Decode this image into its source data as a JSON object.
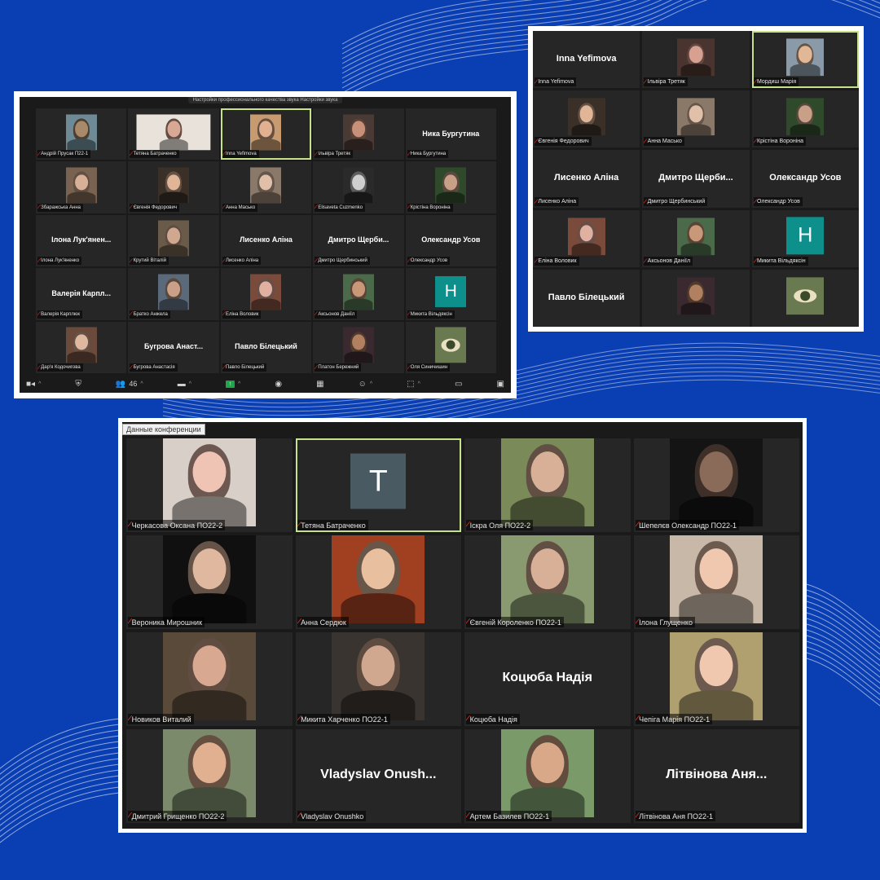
{
  "colors": {
    "background": "#0a3fb3",
    "tile": "#262626",
    "active_border": "#c7e38a",
    "muted_mic": "#e0312b",
    "avatar_teal": "#0d8f8c",
    "avatar_slate": "#4a5a63"
  },
  "top_left": {
    "top_note": "Настройки профессионального качества звука   Настройки звука",
    "tiles": [
      {
        "label": "Андрій Прусак П22-1",
        "type": "photo",
        "tone": "#a88a6a",
        "bg": "#6d8a96"
      },
      {
        "label": "Тетяна Батраченко",
        "type": "photo",
        "tone": "#d9a894",
        "bg": "#e8e2da",
        "wide": true
      },
      {
        "label": "Inna Yefimova",
        "type": "photo",
        "tone": "#e0b090",
        "bg": "#c79a6f",
        "active": true
      },
      {
        "label": "Ільвіра Третяк",
        "type": "photo",
        "tone": "#c89078",
        "bg": "#4a3a36"
      },
      {
        "label": "Ника Бургутина",
        "type": "name",
        "name": "Ника Бургутина"
      },
      {
        "label": "Збаражська Анна",
        "type": "photo",
        "tone": "#d8b098",
        "bg": "#7a6250"
      },
      {
        "label": "Євгенія Федорович",
        "type": "photo",
        "tone": "#e0b598",
        "bg": "#3a3028"
      },
      {
        "label": "Анна Масько",
        "type": "photo",
        "tone": "#e0c0a8",
        "bg": "#8a7868"
      },
      {
        "label": "Elisaveta Cuzmenko",
        "type": "photo",
        "tone": "#cfcfcf",
        "bg": "#2a2a2a"
      },
      {
        "label": "Крістіна Вороніна",
        "type": "photo",
        "tone": "#c8a088",
        "bg": "#2f4a2a"
      },
      {
        "label": "Ілона Лук'яненко",
        "type": "name",
        "name": "Ілона Лук'янен..."
      },
      {
        "label": "Крутий Віталій",
        "type": "photo",
        "tone": "#d0a890",
        "bg": "#6a5a4a"
      },
      {
        "label": "Лисенко Аліна",
        "type": "name",
        "name": "Лисенко Аліна"
      },
      {
        "label": "Дмитро Щербинський",
        "type": "name",
        "name": "Дмитро Щерби..."
      },
      {
        "label": "Олександр Усов",
        "type": "name",
        "name": "Олександр Усов"
      },
      {
        "label": "Валерія Карплюк",
        "type": "name",
        "name": "Валерія Карпл..."
      },
      {
        "label": "Братко Анжела",
        "type": "photo",
        "tone": "#caa088",
        "bg": "#5a6a7a"
      },
      {
        "label": "Еліна Воловик",
        "type": "photo",
        "tone": "#e0b0a0",
        "bg": "#7a4a3a"
      },
      {
        "label": "Аксьонов Даніїл",
        "type": "photo",
        "tone": "#c89878",
        "bg": "#4a6a4a"
      },
      {
        "label": "Микита Вільдяксін",
        "type": "avatar",
        "letter": "H",
        "avatar_color": "#0d8f8c"
      },
      {
        "label": "Дар'я Кодочигова",
        "type": "photo",
        "tone": "#e0b8a0",
        "bg": "#6a4a3a"
      },
      {
        "label": "Бугрова Анастасія",
        "type": "name",
        "name": "Бугрова Анаст..."
      },
      {
        "label": "Павло Білецький",
        "type": "name",
        "name": "Павло Білецький"
      },
      {
        "label": "Платон Бережний",
        "type": "photo",
        "tone": "#b08060",
        "bg": "#3a2a30"
      },
      {
        "label": "Оля Синичишин",
        "type": "photo",
        "tone": "#9aa07a",
        "bg": "#6a7a50",
        "eye": true
      }
    ],
    "toolbar": {
      "participants_count": "46"
    }
  },
  "top_right": {
    "tiles": [
      {
        "label": "Inna Yefimova",
        "type": "name",
        "name": "Inna Yefimova"
      },
      {
        "label": "Ільвіра Третяк",
        "type": "photo",
        "tone": "#d8a090",
        "bg": "#4a3430"
      },
      {
        "label": "Мордиш Марія",
        "type": "photo",
        "tone": "#e0b898",
        "bg": "#8a9aa8",
        "active": true
      },
      {
        "label": "Євгенія Федорович",
        "type": "photo",
        "tone": "#e0b598",
        "bg": "#3a3028"
      },
      {
        "label": "Анна Масько",
        "type": "photo",
        "tone": "#e0c0a8",
        "bg": "#8a7868"
      },
      {
        "label": "Крістіна Вороніна",
        "type": "photo",
        "tone": "#c8a088",
        "bg": "#2f4a2a"
      },
      {
        "label": "Лисенко Аліна",
        "type": "name",
        "name": "Лисенко Аліна"
      },
      {
        "label": "Дмитро Щербинський",
        "type": "name",
        "name": "Дмитро Щерби..."
      },
      {
        "label": "Олександр Усов",
        "type": "name",
        "name": "Олександр Усов"
      },
      {
        "label": "Еліна Воловик",
        "type": "photo",
        "tone": "#e0b0a0",
        "bg": "#7a4a3a"
      },
      {
        "label": "Аксьонов Даніїл",
        "type": "photo",
        "tone": "#c89878",
        "bg": "#4a6a4a"
      },
      {
        "label": "Микита Вільдяксін",
        "type": "avatar",
        "letter": "H",
        "avatar_color": "#0d8f8c"
      },
      {
        "label": "",
        "type": "name",
        "name": "Павло Білецький"
      },
      {
        "label": "",
        "type": "photo",
        "tone": "#b08060",
        "bg": "#3a2a30"
      },
      {
        "label": "",
        "type": "photo",
        "tone": "#9aa07a",
        "bg": "#6a7a50",
        "eye": true
      }
    ]
  },
  "bottom": {
    "tab_label": "Данные конференции",
    "tiles": [
      {
        "label": "Черкасова Оксана ПО22-2",
        "type": "photo",
        "tone": "#f0c4b4",
        "bg": "#d8cfc8"
      },
      {
        "label": "Тетяна Батраченко",
        "type": "avatar",
        "letter": "T",
        "avatar_color": "#4a5a63",
        "active": true
      },
      {
        "label": "Іскра Оля ПО22-2",
        "type": "photo",
        "tone": "#d8b098",
        "bg": "#7a8a58"
      },
      {
        "label": "Шепелєв Олександр  ПО22-1",
        "type": "photo",
        "tone": "#8a6a58",
        "bg": "#141414"
      },
      {
        "label": "Вероника Мирошник",
        "type": "photo",
        "tone": "#e0b8a0",
        "bg": "#101010"
      },
      {
        "label": "Анна Сердюк",
        "type": "photo",
        "tone": "#e8c0a0",
        "bg": "#a04020"
      },
      {
        "label": "Євгеній Короленко ПО22-1",
        "type": "photo",
        "tone": "#d8b098",
        "bg": "#8a9a70"
      },
      {
        "label": "Ілона Глущенко",
        "type": "photo",
        "tone": "#f0c8b0",
        "bg": "#c8b8a8"
      },
      {
        "label": "Новиков Виталий",
        "type": "photo",
        "tone": "#d8a890",
        "bg": "#5a4a3a"
      },
      {
        "label": "Микита Харченко ПО22-1",
        "type": "photo",
        "tone": "#d0a890",
        "bg": "#3a3430"
      },
      {
        "label": "Коцюба Надія",
        "type": "name",
        "name": "Коцюба Надія"
      },
      {
        "label": "Чепіга Марія ПО22-1",
        "type": "photo",
        "tone": "#f0c8b0",
        "bg": "#b0a070"
      },
      {
        "label": "Дмитрий Грищенко ПО22-2",
        "type": "photo",
        "tone": "#e0b090",
        "bg": "#7a8a6a"
      },
      {
        "label": "Vladyslav Onushko",
        "type": "name",
        "name": "Vladyslav  Onush..."
      },
      {
        "label": "Артем Базилев ПО22-1",
        "type": "photo",
        "tone": "#d8a888",
        "bg": "#7a9a6a"
      },
      {
        "label": "Літвінова Аня ПО22-1",
        "type": "name",
        "name": "Літвінова Аня..."
      }
    ]
  }
}
